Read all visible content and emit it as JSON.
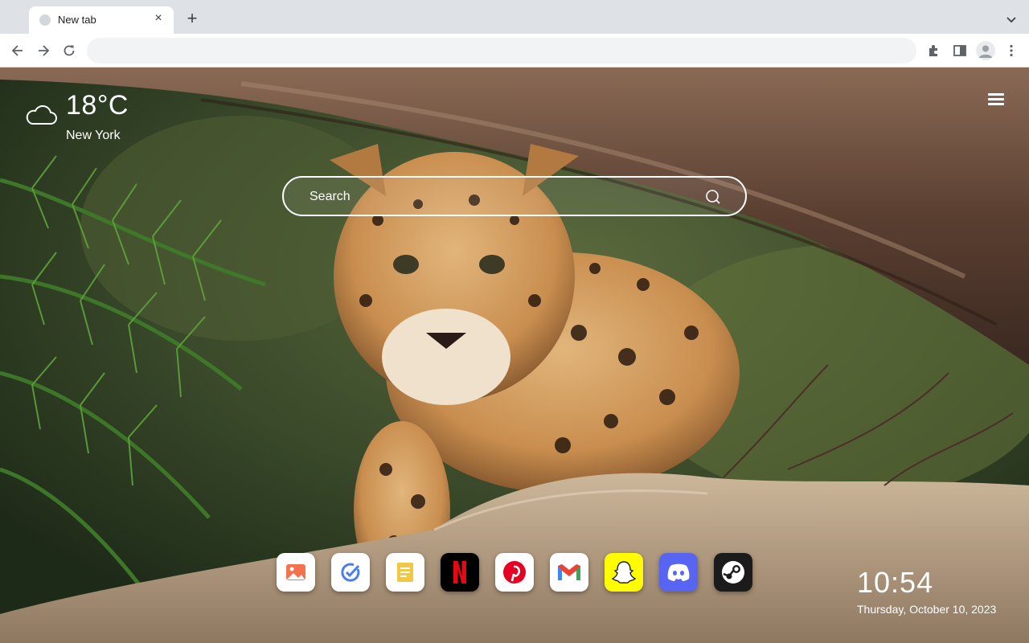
{
  "browser": {
    "tab_title": "New tab",
    "omnibox_value": "",
    "icons": {
      "favicon": "favicon-icon",
      "close": "close-icon",
      "new_tab": "plus-icon",
      "tab_search": "chevron-down-icon",
      "back": "back-arrow-icon",
      "forward": "forward-arrow-icon",
      "reload": "reload-icon",
      "extensions": "puzzle-icon",
      "side_panel": "side-panel-icon",
      "profile": "profile-avatar-icon",
      "menu": "vertical-dots-icon"
    }
  },
  "weather": {
    "temperature": "18°C",
    "city": "New York",
    "icon": "cloud-icon"
  },
  "search": {
    "placeholder": "Search",
    "icon": "search-icon"
  },
  "menu": {
    "icon": "hamburger-icon"
  },
  "apps": [
    {
      "name": "Photos",
      "icon": "photos-icon",
      "bg": "#ffffff",
      "accent": "#f4734f"
    },
    {
      "name": "Tasks",
      "icon": "tasks-icon",
      "bg": "#ffffff",
      "accent": "#4a7df0"
    },
    {
      "name": "Notes",
      "icon": "notes-icon",
      "bg": "#ffffff",
      "accent": "#f2c744"
    },
    {
      "name": "Netflix",
      "icon": "netflix-icon",
      "bg": "#000000",
      "accent": "#e50914"
    },
    {
      "name": "Pinterest",
      "icon": "pinterest-icon",
      "bg": "#ffffff",
      "accent": "#e60023"
    },
    {
      "name": "Gmail",
      "icon": "gmail-icon",
      "bg": "#ffffff",
      "accent": "#ea4335"
    },
    {
      "name": "Snapchat",
      "icon": "snapchat-icon",
      "bg": "#fffc00",
      "accent": "#ffffff"
    },
    {
      "name": "Discord",
      "icon": "discord-icon",
      "bg": "#5865f2",
      "accent": "#ffffff"
    },
    {
      "name": "Steam",
      "icon": "steam-icon",
      "bg": "#1b1b1b",
      "accent": "#ffffff"
    }
  ],
  "clock": {
    "time": "10:54",
    "date": "Thursday, October 10, 2023"
  }
}
